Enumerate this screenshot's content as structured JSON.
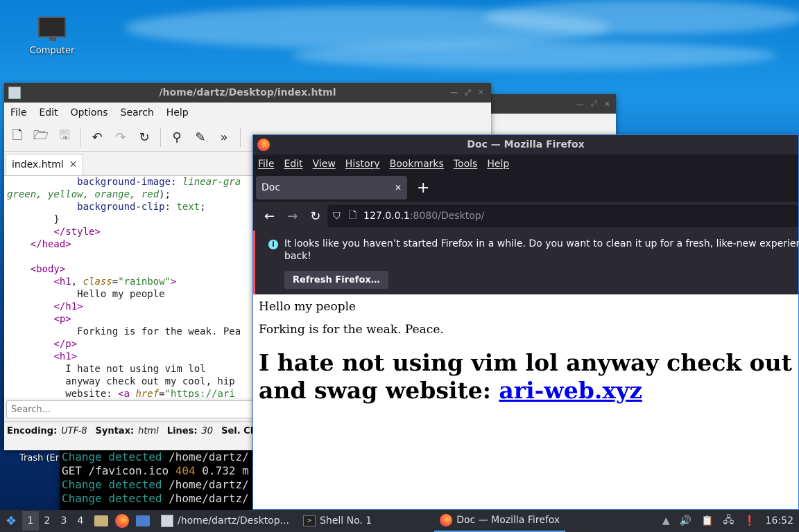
{
  "desktop": {
    "computer_label": "Computer",
    "trash_label": "Trash (Er"
  },
  "editor": {
    "title": "/home/dartz/Desktop/index.html",
    "menu": [
      "File",
      "Edit",
      "Options",
      "Search",
      "Help"
    ],
    "tab_label": "index.html",
    "search_placeholder": "Search...",
    "status": {
      "encoding_label": "Encoding:",
      "encoding_value": "UTF-8",
      "syntax_label": "Syntax:",
      "syntax_value": "html",
      "lines_label": "Lines:",
      "lines_value": "30",
      "selchar_label": "Sel. Char"
    }
  },
  "terminal": {
    "lines": [
      {
        "a": "Change detected",
        "b": " /home/dartz/"
      },
      {
        "a": "GET /favicon.ico ",
        "n": "404",
        "b": " 0.732 m"
      },
      {
        "a": "Change detected",
        "b": " /home/dartz/"
      },
      {
        "a": "Change detected",
        "b": " /home/dartz/"
      }
    ]
  },
  "firefox": {
    "title": "Doc — Mozilla Firefox",
    "menu": [
      "File",
      "Edit",
      "View",
      "History",
      "Bookmarks",
      "Tools",
      "Help"
    ],
    "tab_label": "Doc",
    "url_host": "127.0.0.1",
    "url_rest": ":8080/Desktop/",
    "notice_text": "It looks like you haven’t started Firefox in a while. Do you want to clean it up for a fresh, like-new experience? A",
    "notice_text2": "back!",
    "refresh_button": "Refresh Firefox…",
    "page_h": "Hello my people",
    "page_p": "Forking is for the weak. Peace.",
    "page_h1_line1": "I hate not using vim lol anyway check out m",
    "page_h1_line2a": "and swag website: ",
    "page_link": "ari-web.xyz"
  },
  "taskbar": {
    "workspaces": [
      "1",
      "2",
      "3",
      "4"
    ],
    "task_editor": "/home/dartz/Desktop...",
    "task_shell": "Shell No. 1",
    "task_firefox": "Doc — Mozilla Firefox",
    "clock": "16:52"
  },
  "colors": {
    "accent": "#0060df",
    "link": "#0000ee",
    "notice_border": "#ff4f5e"
  }
}
